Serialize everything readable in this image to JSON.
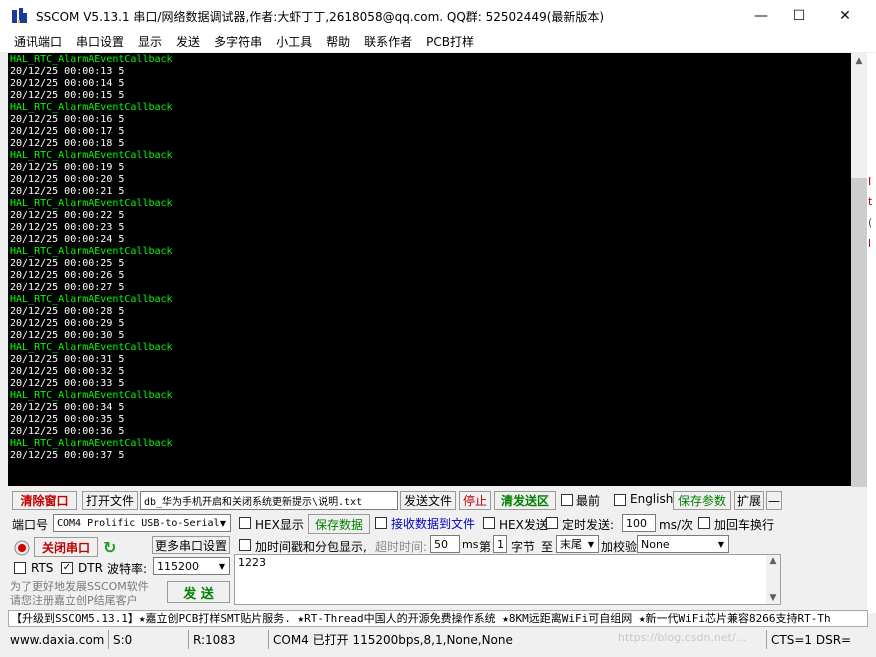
{
  "window": {
    "title": "SSCOM V5.13.1 串口/网络数据调试器,作者:大虾丁丁,2618058@qq.com. QQ群: 52502449(最新版本)"
  },
  "menu": [
    "通讯端口",
    "串口设置",
    "显示",
    "发送",
    "多字符串",
    "小工具",
    "帮助",
    "联系作者",
    "PCB打样"
  ],
  "console": {
    "colors": {
      "callback": "#00ff00",
      "data": "#ffffff",
      "background": "#000000"
    },
    "lines": [
      {
        "text": "HAL_RTC_AlarmAEventCallback",
        "kind": "callback"
      },
      {
        "text": "20/12/25 00:00:13 5",
        "kind": "data"
      },
      {
        "text": "20/12/25 00:00:14 5",
        "kind": "data"
      },
      {
        "text": "20/12/25 00:00:15 5",
        "kind": "data"
      },
      {
        "text": "HAL_RTC_AlarmAEventCallback",
        "kind": "callback"
      },
      {
        "text": "20/12/25 00:00:16 5",
        "kind": "data"
      },
      {
        "text": "20/12/25 00:00:17 5",
        "kind": "data"
      },
      {
        "text": "20/12/25 00:00:18 5",
        "kind": "data"
      },
      {
        "text": "HAL_RTC_AlarmAEventCallback",
        "kind": "callback"
      },
      {
        "text": "20/12/25 00:00:19 5",
        "kind": "data"
      },
      {
        "text": "20/12/25 00:00:20 5",
        "kind": "data"
      },
      {
        "text": "20/12/25 00:00:21 5",
        "kind": "data"
      },
      {
        "text": "HAL_RTC_AlarmAEventCallback",
        "kind": "callback"
      },
      {
        "text": "20/12/25 00:00:22 5",
        "kind": "data"
      },
      {
        "text": "20/12/25 00:00:23 5",
        "kind": "data"
      },
      {
        "text": "20/12/25 00:00:24 5",
        "kind": "data"
      },
      {
        "text": "HAL_RTC_AlarmAEventCallback",
        "kind": "callback"
      },
      {
        "text": "20/12/25 00:00:25 5",
        "kind": "data"
      },
      {
        "text": "20/12/25 00:00:26 5",
        "kind": "data"
      },
      {
        "text": "20/12/25 00:00:27 5",
        "kind": "data"
      },
      {
        "text": "HAL_RTC_AlarmAEventCallback",
        "kind": "callback"
      },
      {
        "text": "20/12/25 00:00:28 5",
        "kind": "data"
      },
      {
        "text": "20/12/25 00:00:29 5",
        "kind": "data"
      },
      {
        "text": "20/12/25 00:00:30 5",
        "kind": "data"
      },
      {
        "text": "HAL_RTC_AlarmAEventCallback",
        "kind": "callback"
      },
      {
        "text": "20/12/25 00:00:31 5",
        "kind": "data"
      },
      {
        "text": "20/12/25 00:00:32 5",
        "kind": "data"
      },
      {
        "text": "20/12/25 00:00:33 5",
        "kind": "data"
      },
      {
        "text": "HAL_RTC_AlarmAEventCallback",
        "kind": "callback"
      },
      {
        "text": "20/12/25 00:00:34 5",
        "kind": "data"
      },
      {
        "text": "20/12/25 00:00:35 5",
        "kind": "data"
      },
      {
        "text": "20/12/25 00:00:36 5",
        "kind": "data"
      },
      {
        "text": "HAL_RTC_AlarmAEventCallback",
        "kind": "callback"
      },
      {
        "text": "20/12/25 00:00:37 5",
        "kind": "data"
      }
    ]
  },
  "toolbar": {
    "clear": "清除窗口",
    "open_file": "打开文件",
    "file_path": "db_华为手机开启和关闭系统更新提示\\说明.txt",
    "send_file": "发送文件",
    "stop": "停止",
    "clear_send": "清发送区",
    "top_most": "最前",
    "english": "English",
    "save_params": "保存参数",
    "expand": "扩展",
    "collapse": "—"
  },
  "options": {
    "port_label": "端口号",
    "port_value": "COM4 Prolific USB-to-Serial",
    "hex_display": "HEX显示",
    "save_data": "保存数据",
    "recv_to_file": "接收数据到文件",
    "hex_send": "HEX发送",
    "timed_send": "定时发送:",
    "timed_value": "100",
    "timed_unit": "ms/次",
    "add_crlf": "加回车换行",
    "close_port": "关闭串口",
    "more_settings": "更多串口设置",
    "timestamp": "加时间戳和分包显示,",
    "timeout_label": "超时时间:",
    "timeout_value": "50",
    "timeout_unit": "ms",
    "nth_label": "第",
    "nth_value": "1",
    "byte_label": "字节",
    "to_label": "至",
    "tail_value": "末尾",
    "checksum_label": "加校验",
    "checksum_value": "None",
    "rts": "RTS",
    "dtr": "DTR",
    "baud_label": "波特率:",
    "baud_value": "115200",
    "send_text": "1223",
    "send_button": "发 送",
    "promo": "为了更好地发展SSCOM软件\n请您注册嘉立创P结尾客户"
  },
  "ticker": "【升级到SSCOM5.13.1】★嘉立创PCB打样SMT贴片服务. ★RT-Thread中国人的开源免费操作系统 ★8KM远距离WiFi可自组网 ★新一代WiFi芯片兼容8266支持RT-Th",
  "status": {
    "url": "www.daxia.com",
    "sent": "S:0",
    "received": "R:1083",
    "port_state": "COM4 已打开  115200bps,8,1,None,None",
    "signals": "CTS=1 DSR=",
    "watermark": "https://blog.csdn.net/..."
  },
  "bg_letters": [
    "I",
    "t",
    "(",
    "l"
  ]
}
